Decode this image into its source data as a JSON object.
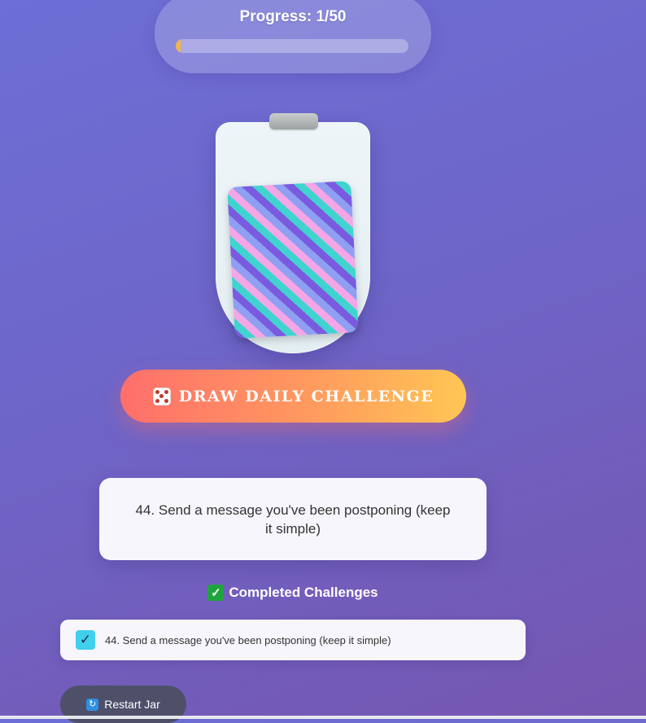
{
  "progress": {
    "label": "Progress: 1/50",
    "completed": 1,
    "total": 50,
    "fill_color": "#f2b54c"
  },
  "jar": {
    "card_pattern_colors": [
      "#7a5be0",
      "#3fd4cf",
      "#f4a6e6",
      "#8f9ff2"
    ]
  },
  "draw_button": {
    "icon": "dice-icon",
    "label": "DRAW DAILY CHALLENGE"
  },
  "current_challenge": {
    "text": "44. Send a message you've been postponing (keep it simple)"
  },
  "completed_section": {
    "icon": "check-mark-icon",
    "heading": "Completed Challenges",
    "items": [
      {
        "checked": true,
        "text": "44. Send a message you've been postponing (keep it simple)"
      }
    ]
  },
  "restart_button": {
    "icon": "refresh-icon",
    "label": "Restart Jar"
  }
}
